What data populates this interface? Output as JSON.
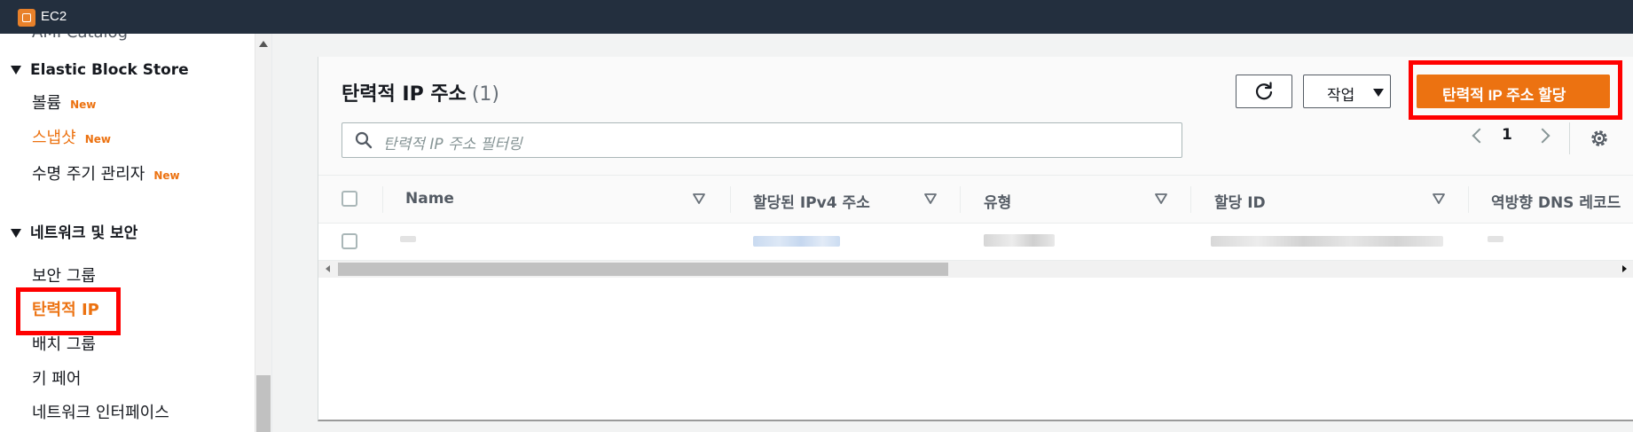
{
  "topbar": {
    "service": "EC2"
  },
  "sidebar": {
    "cut_item": "AMI Catalog",
    "sections": {
      "ebs": {
        "title": "Elastic Block Store",
        "items": [
          {
            "label": "볼륨",
            "badge": "New"
          },
          {
            "label": "스냅샷",
            "badge": "New"
          },
          {
            "label": "수명 주기 관리자",
            "badge": "New"
          }
        ]
      },
      "network": {
        "title": "네트워크 및 보안",
        "items": [
          {
            "label": "보안 그룹"
          },
          {
            "label": "탄력적 IP"
          },
          {
            "label": "배치 그룹"
          },
          {
            "label": "키 페어"
          },
          {
            "label": "네트워크 인터페이스"
          }
        ]
      }
    }
  },
  "main": {
    "title": "탄력적 IP 주소",
    "count": "(1)",
    "action_label": "작업",
    "primary_label": "탄력적 IP 주소 할당",
    "search_placeholder": "탄력적 IP 주소 필터링",
    "page": "1",
    "columns": [
      "Name",
      "할당된 IPv4 주소",
      "유형",
      "할당 ID",
      "역방향 DNS 레코드"
    ]
  },
  "icons": {
    "refresh": "refresh-icon",
    "search": "search-icon",
    "gear": "gear-icon",
    "sort": "sort-caret-icon"
  },
  "colors": {
    "accent": "#ec7211",
    "topbar": "#232f3e",
    "highlight": "#ff0000"
  }
}
